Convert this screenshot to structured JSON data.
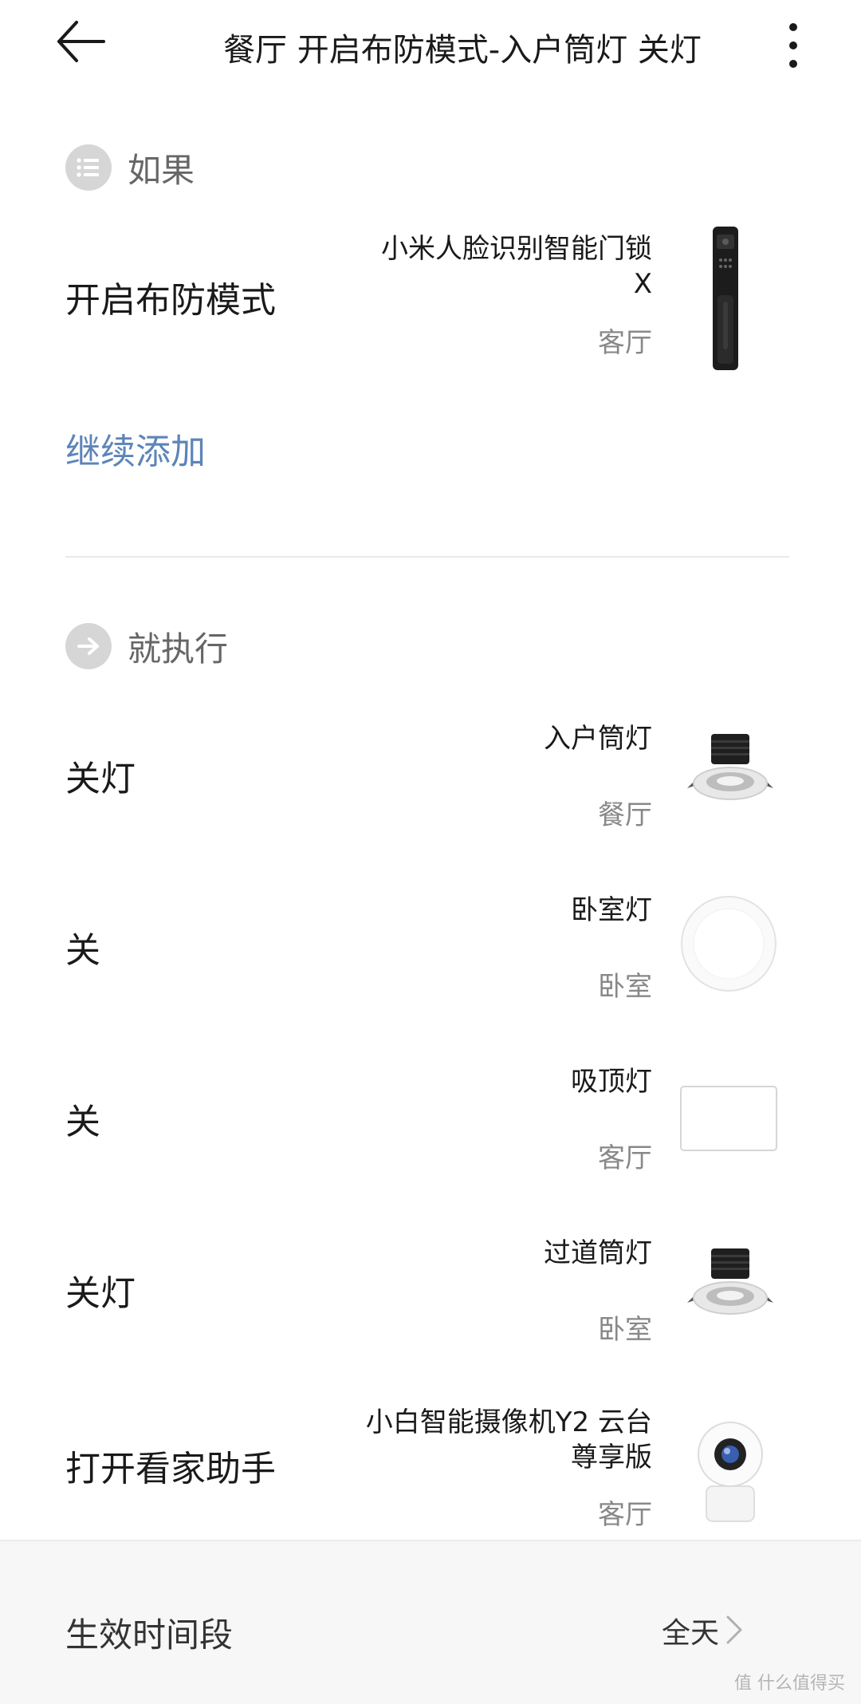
{
  "header": {
    "title": "餐厅 开启布防模式-入户筒灯 关灯"
  },
  "condition_section": {
    "label": "如果",
    "rows": [
      {
        "action": "开启布防模式",
        "device": "小米人脸识别智能门锁X",
        "room": "客厅"
      }
    ],
    "add_more": "继续添加"
  },
  "action_section": {
    "label": "就执行",
    "rows": [
      {
        "action": "关灯",
        "device": "入户筒灯",
        "room": "餐厅"
      },
      {
        "action": "关",
        "device": "卧室灯",
        "room": "卧室"
      },
      {
        "action": "关",
        "device": "吸顶灯",
        "room": "客厅"
      },
      {
        "action": "关灯",
        "device": "过道筒灯",
        "room": "卧室"
      },
      {
        "action": "打开看家助手",
        "device": "小白智能摄像机Y2 云台尊享版",
        "room": "客厅"
      }
    ]
  },
  "footer": {
    "label": "生效时间段",
    "value": "全天"
  },
  "watermark": "值 什么值得买",
  "colors": {
    "accent_link": "#5c85b8",
    "icon_circle": "#d6d6d6",
    "secondary_text": "#888888"
  }
}
